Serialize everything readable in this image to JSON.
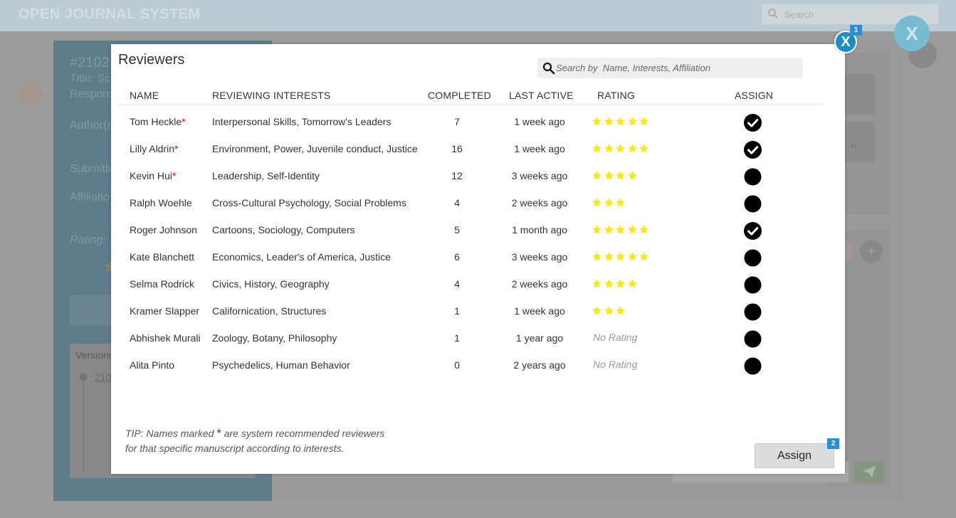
{
  "app": {
    "title": "OPEN JOURNAL SYSTEM",
    "search_placeholder": "Search",
    "close_label": "X"
  },
  "background": {
    "submission_id": "#2102",
    "title_label": "Title: Sc",
    "response_label": "Respons",
    "authors_label": "Author(s",
    "submitted_label": "Submitte",
    "affiliation_label": "Affiliatio",
    "rating_label": "Rating:",
    "versions_label": "Versions",
    "version_item": "210",
    "rightcard_text": "n"
  },
  "modal": {
    "title": "Reviewers",
    "close_label": "X",
    "close_badge": "1",
    "search_placeholder": "Search by  Name, Interests, Affiliation",
    "columns": {
      "name": "NAME",
      "interests": "REVIEWING INTERESTS",
      "completed": "COMPLETED",
      "last_active": "LAST ACTIVE",
      "rating": "RATING",
      "assign": "ASSIGN"
    },
    "no_rating_label": "No Rating",
    "reviewers": [
      {
        "name": "Tom Heckle",
        "recommended": true,
        "interests": "Interpersonal Skills, Tomorrow's Leaders",
        "completed": "7",
        "last_active": "1 week ago",
        "rating": 5,
        "assigned": true
      },
      {
        "name": "Lilly Aldrin",
        "recommended": true,
        "interests": "Environment, Power, Juvenile conduct, Justice",
        "completed": "16",
        "last_active": "1 week ago",
        "rating": 5,
        "assigned": true
      },
      {
        "name": "Kevin Hui",
        "recommended": true,
        "interests": "Leadership, Self-Identity",
        "completed": "12",
        "last_active": "3 weeks ago",
        "rating": 4,
        "assigned": false
      },
      {
        "name": "Ralph Woehle",
        "recommended": false,
        "interests": "Cross-Cultural Psychology, Social Problems",
        "completed": "4",
        "last_active": "2 weeks ago",
        "rating": 3,
        "assigned": false
      },
      {
        "name": "Roger Johnson",
        "recommended": false,
        "interests": "Cartoons, Sociology, Computers",
        "completed": "5",
        "last_active": "1 month ago",
        "rating": 5,
        "assigned": true
      },
      {
        "name": "Kate Blanchett",
        "recommended": false,
        "interests": "Economics, Leader's of America, Justice",
        "completed": "6",
        "last_active": "3 weeks ago",
        "rating": 5,
        "assigned": false
      },
      {
        "name": "Selma Rodrick",
        "recommended": false,
        "interests": "Civics, History, Geography",
        "completed": "4",
        "last_active": "2 weeks ago",
        "rating": 4,
        "assigned": false
      },
      {
        "name": "Kramer Slapper",
        "recommended": false,
        "interests": "Californication, Structures",
        "completed": "1",
        "last_active": "1 week ago",
        "rating": 3,
        "assigned": false
      },
      {
        "name": "Abhishek Murali",
        "recommended": false,
        "interests": "Zoology, Botany, Philosophy",
        "completed": "1",
        "last_active": "1 year ago",
        "rating": 0,
        "assigned": false
      },
      {
        "name": "Alita Pinto",
        "recommended": false,
        "interests": "Psychedelics, Human Behavior",
        "completed": "0",
        "last_active": "2 years ago",
        "rating": 0,
        "assigned": false
      }
    ],
    "tip_line1_before": "TIP: Names marked",
    "tip_line1_after": "are system recommended reviewers",
    "tip_line2": "for that specific manuscript according to interests.",
    "required_marker": "*",
    "assign_button": "Assign",
    "assign_badge": "2"
  },
  "colors": {
    "accent": "#1f8cc4",
    "star": "#f8e71c",
    "required": "#d0021b",
    "badge": "#2b8fd0"
  }
}
